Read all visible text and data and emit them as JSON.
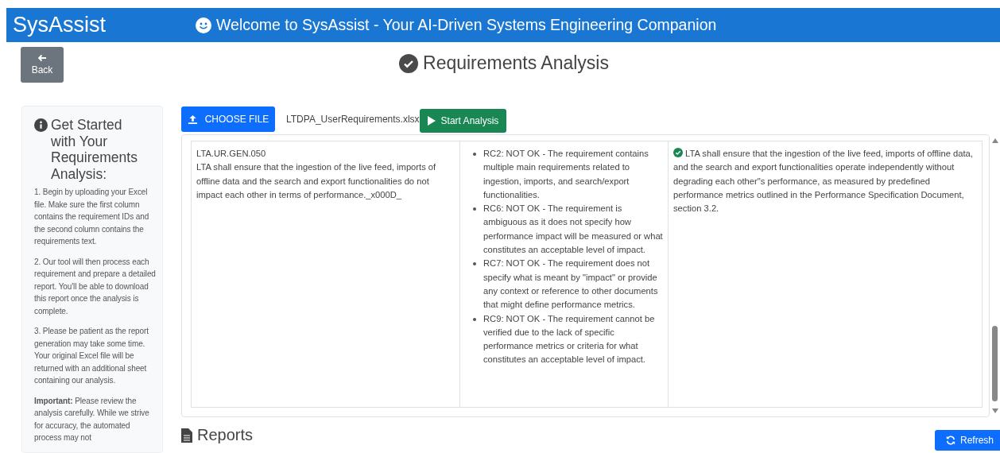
{
  "header": {
    "brand": "SysAssist",
    "welcome": "Welcome to SysAssist - Your AI-Driven Systems Engineering Companion"
  },
  "back_button": "Back",
  "page_title": "Requirements Analysis",
  "sidebar": {
    "title": "Get Started with Your Requirements Analysis:",
    "paragraphs": [
      "1. Begin by uploading your Excel file. Make sure the first column contains the requirement IDs and the second column contains the requirements text.",
      "2. Our tool will then process each requirement and prepare a detailed report. You'll be able to download this report once the analysis is complete.",
      "3. Please be patient as the report generation may take some time. Your original Excel file will be returned with an additional sheet containing our analysis.",
      "**Important:** Please review the analysis carefully. While we strive for accuracy, the automated process may not"
    ]
  },
  "upload": {
    "choose_button": "CHOOSE FILE",
    "file_name": "LTDPA_UserRequirements.xlsx",
    "start_button": "Start Analysis"
  },
  "results": {
    "rows": [
      {
        "requirement_id": "LTA.UR.GEN.050",
        "requirement_text": "LTA shall ensure that the ingestion of the live feed, imports of offline data and the search and export functionalities do not impact each other in terms of performance._x000D_",
        "findings": [
          "RC2: NOT OK - The requirement contains multiple main requirements related to ingestion, imports, and search/export functionalities.",
          "RC6: NOT OK - The requirement is ambiguous as it does not specify how performance impact will be measured or what constitutes an acceptable level of impact.",
          "RC7: NOT OK - The requirement does not specify what is meant by \"impact\" or provide any context or reference to other documents that might define performance metrics.",
          "RC9: NOT OK - The requirement cannot be verified due to the lack of specific performance metrics or criteria for what constitutes an acceptable level of impact."
        ],
        "proposal_approved": true,
        "proposal": "LTA shall ensure that the ingestion of the live feed, imports of offline data, and the search and export functionalities operate independently without degrading each other\"s performance, as measured by predefined performance metrics outlined in the Performance Specification Document, section 3.2."
      }
    ]
  },
  "reports": {
    "title": "Reports",
    "refresh_button": "Refresh"
  }
}
